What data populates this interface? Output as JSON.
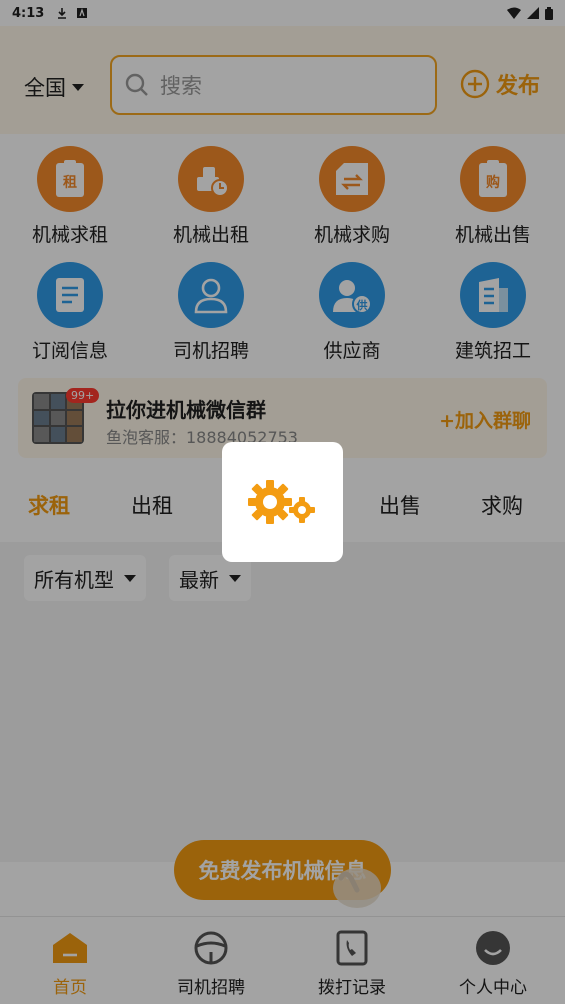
{
  "status_bar": {
    "time": "4:13",
    "icons": [
      "download-icon",
      "keyboard-icon",
      "wifi-icon",
      "signal-icon",
      "battery-icon"
    ]
  },
  "header": {
    "region": "全国",
    "search_placeholder": "搜索",
    "publish_label": "发布",
    "accent_color": "#f39c12"
  },
  "grid": {
    "items": [
      {
        "label": "机械求租",
        "icon": "rent-request-icon",
        "color": "#f58a2b"
      },
      {
        "label": "机械出租",
        "icon": "rent-out-icon",
        "color": "#f58a2b"
      },
      {
        "label": "机械求购",
        "icon": "purchase-request-icon",
        "color": "#f58a2b"
      },
      {
        "label": "机械出售",
        "icon": "sell-icon",
        "color": "#f58a2b"
      },
      {
        "label": "订阅信息",
        "icon": "subscribe-icon",
        "color": "#2f9be8"
      },
      {
        "label": "司机招聘",
        "icon": "driver-recruit-icon",
        "color": "#2f9be8"
      },
      {
        "label": "供应商",
        "icon": "supplier-icon",
        "color": "#2f9be8"
      },
      {
        "label": "建筑招工",
        "icon": "construction-recruit-icon",
        "color": "#2f9be8"
      }
    ]
  },
  "banner": {
    "badge": "99+",
    "title": "拉你进机械微信群",
    "subtitle": "鱼泡客服：18884052753",
    "action": "+加入群聊"
  },
  "tabs": {
    "items": [
      {
        "label": "求租",
        "active": true
      },
      {
        "label": "出租",
        "active": false
      },
      {
        "label": "求购",
        "active": false
      },
      {
        "label": "出售",
        "active": false
      },
      {
        "label": "求购",
        "active": false
      }
    ]
  },
  "filters": {
    "machine_type": "所有机型",
    "sort": "最新"
  },
  "fab_label": "免费发布机械信息",
  "bottom_nav": {
    "items": [
      {
        "label": "首页",
        "active": true,
        "icon": "home-icon"
      },
      {
        "label": "司机招聘",
        "active": false,
        "icon": "steering-wheel-icon"
      },
      {
        "label": "拨打记录",
        "active": false,
        "icon": "call-log-icon"
      },
      {
        "label": "个人中心",
        "active": false,
        "icon": "profile-icon"
      }
    ]
  },
  "loading": {
    "icon": "gears-loading-icon",
    "color": "#f39c12"
  }
}
